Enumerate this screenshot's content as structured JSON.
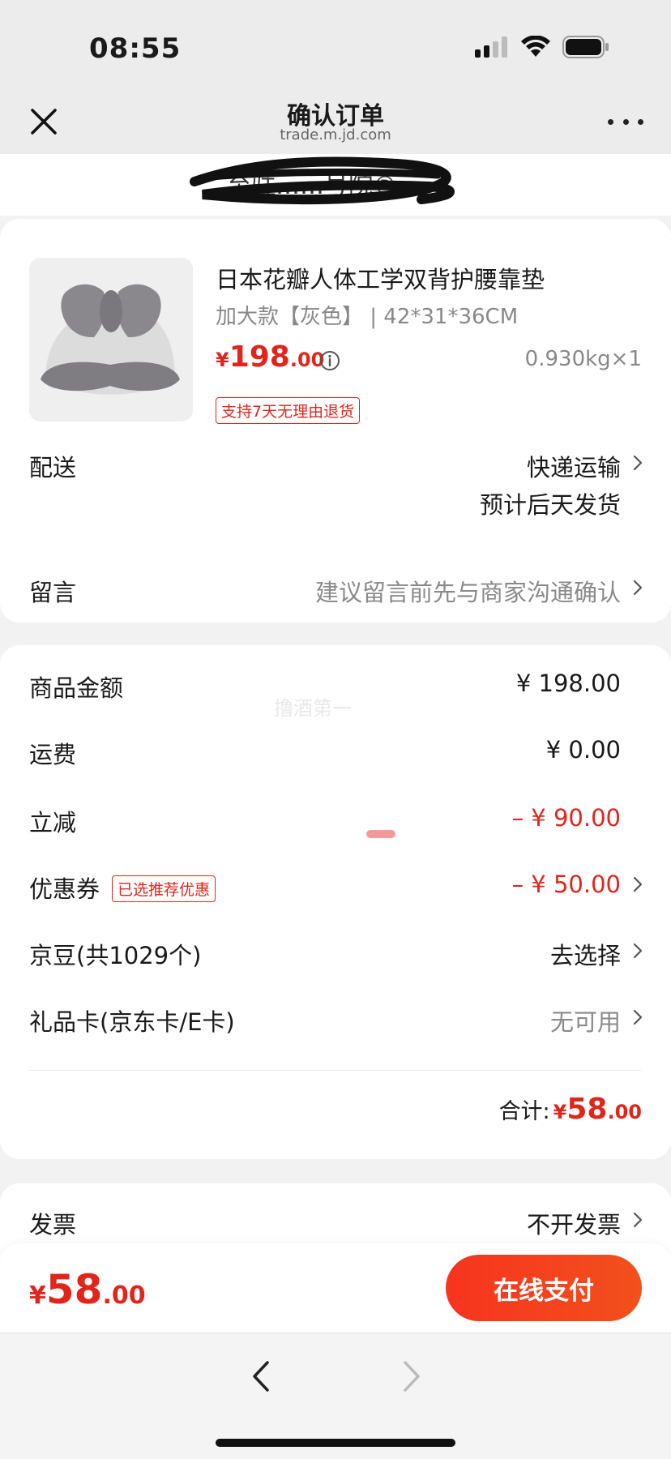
{
  "status_bar": {
    "time": "08:55"
  },
  "nav": {
    "title": "确认订单",
    "url": "trade.m.jd.com"
  },
  "address": {
    "text": "至驻……号院®"
  },
  "product": {
    "name": "日本花瓣人体工学双背护腰靠垫",
    "spec": "加大款【灰色】 | 42*31*36CM",
    "price_currency": "¥",
    "price_int": "198",
    "price_dec": ".00",
    "weight_qty": "0.930kg×1",
    "return_tag": "支持7天无理由退货"
  },
  "delivery": {
    "label": "配送",
    "method": "快递运输",
    "eta": "预计后天发货"
  },
  "message": {
    "label": "留言",
    "placeholder": "建议留言前先与商家沟通确认"
  },
  "price_rows": {
    "goods_label": "商品金额",
    "goods_value": "¥ 198.00",
    "shipping_label": "运费",
    "shipping_value": "¥ 0.00",
    "discount_label": "立减",
    "discount_value": "– ¥ 90.00",
    "coupon_label": "优惠券",
    "coupon_tag": "已选推荐优惠",
    "coupon_value": "– ¥ 50.00",
    "beans_label": "京豆(共1029个)",
    "beans_value": "去选择",
    "giftcard_label": "礼品卡(京东卡/E卡)",
    "giftcard_value": "无可用",
    "total_label": "合计:",
    "total_currency": "¥",
    "total_int": "58",
    "total_dec": ".00",
    "watermark": "撸酒第一"
  },
  "invoice": {
    "label": "发票",
    "value": "不开发票"
  },
  "pay_bar": {
    "currency": "¥",
    "int": "58",
    "dec": ".00",
    "button": "在线支付"
  },
  "colors": {
    "accent": "#e1251b",
    "button": "#f7341f"
  }
}
